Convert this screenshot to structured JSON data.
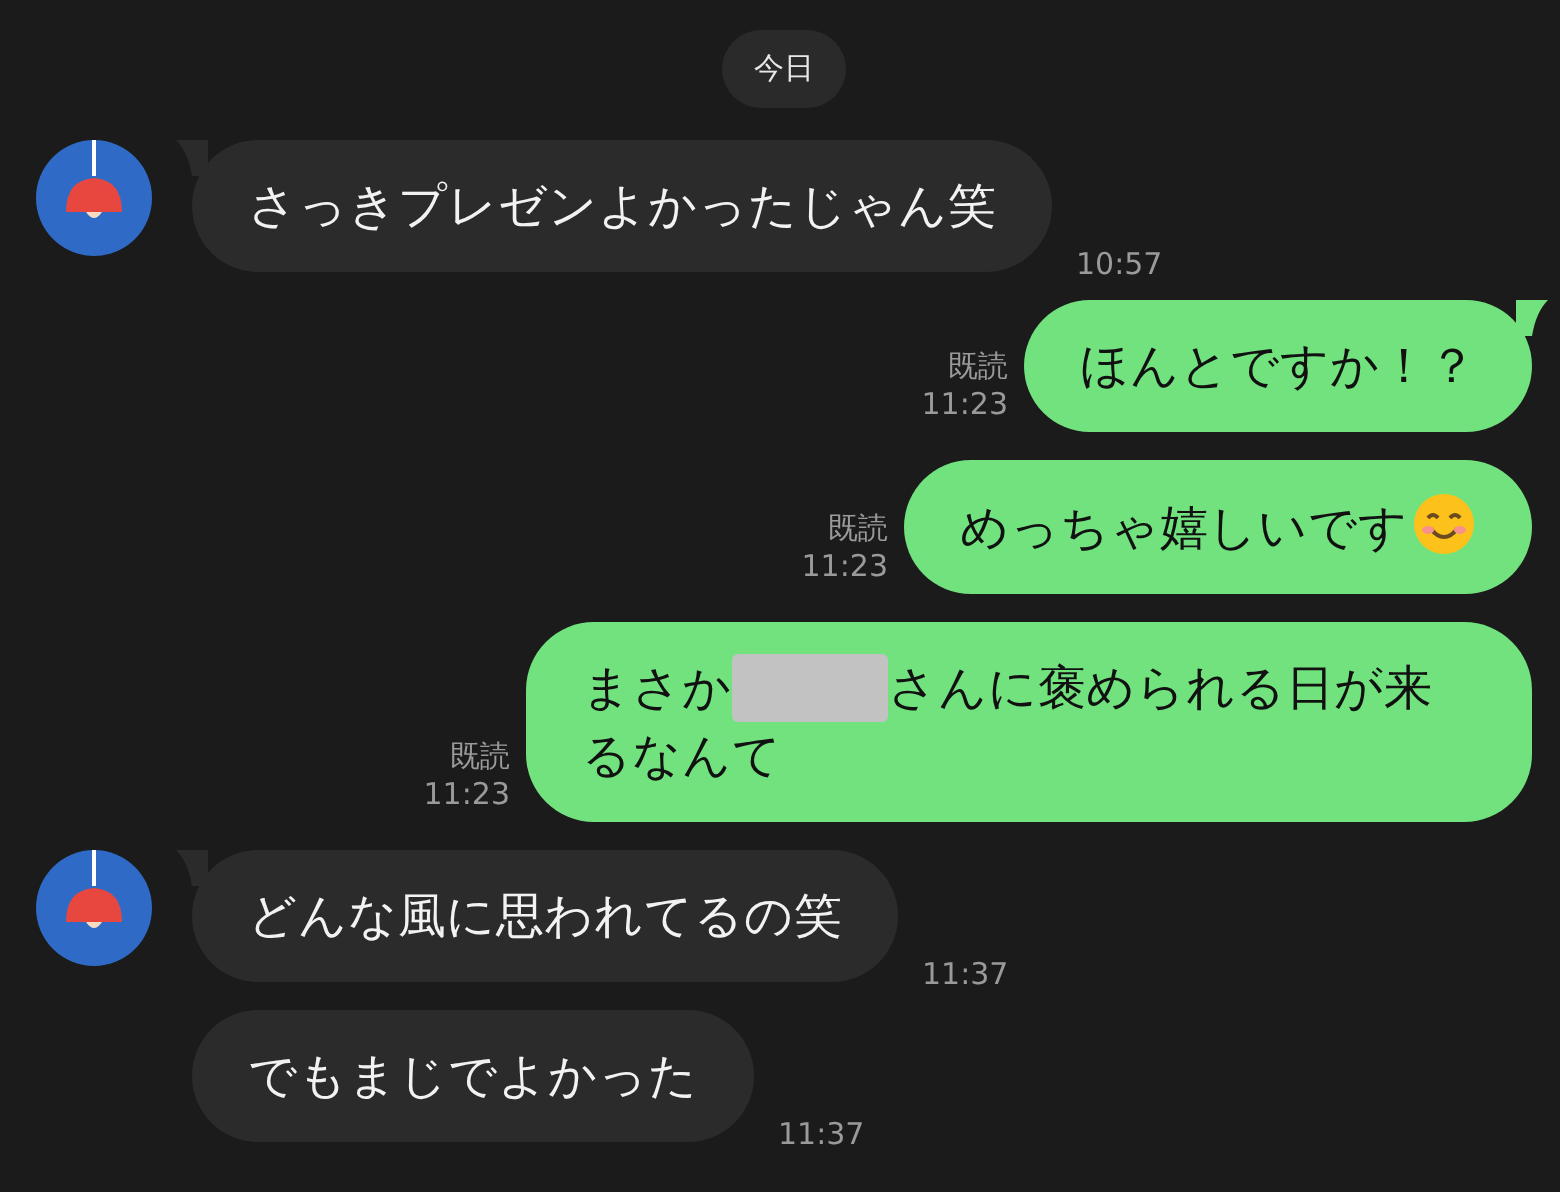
{
  "date_label": "今日",
  "messages": [
    {
      "kind": "incoming",
      "avatar": true,
      "tail": true,
      "segments": [
        {
          "kind": "text",
          "text": "さっきプレゼンよかったじゃん笑"
        }
      ],
      "time": "10:57"
    },
    {
      "kind": "outgoing",
      "tail": true,
      "read_label": "既読",
      "segments": [
        {
          "kind": "text",
          "text": "ほんとですか！？"
        }
      ],
      "time": "11:23"
    },
    {
      "kind": "outgoing",
      "tail": false,
      "read_label": "既読",
      "segments": [
        {
          "kind": "text",
          "text": "めっちゃ嬉しいです"
        },
        {
          "kind": "emoji"
        }
      ],
      "time": "11:23"
    },
    {
      "kind": "outgoing",
      "tail": false,
      "read_label": "既読",
      "segments": [
        {
          "kind": "text",
          "text": "まさか"
        },
        {
          "kind": "redaction"
        },
        {
          "kind": "text",
          "text": "さんに褒められる日が来るなんて"
        }
      ],
      "time": "11:23"
    },
    {
      "kind": "incoming",
      "avatar": true,
      "tail": true,
      "segments": [
        {
          "kind": "text",
          "text": "どんな風に思われてるの笑"
        }
      ],
      "time": "11:37"
    },
    {
      "kind": "incoming",
      "avatar": false,
      "tail": false,
      "segments": [
        {
          "kind": "text",
          "text": "でもまじでよかった"
        }
      ],
      "time": "11:37"
    }
  ]
}
